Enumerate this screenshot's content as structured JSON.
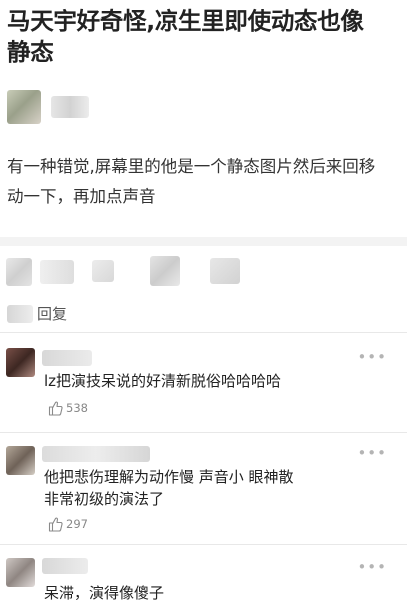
{
  "post": {
    "title_line1": "马天宇好奇怪,凉生里即使动态也像",
    "title_line2": "静态",
    "body_line1": "有一种错觉,屏幕里的他是一个静态图片然后来回移",
    "body_line2": "动一下，再加点声音"
  },
  "replies": {
    "header_label": "回复"
  },
  "comments": [
    {
      "text_lines": [
        "lz把演技呆说的好清新脱俗哈哈哈哈"
      ],
      "likes": "538"
    },
    {
      "text_lines": [
        "他把悲伤理解为动作慢 声音小 眼神散",
        "非常初级的演法了"
      ],
      "likes": "297"
    },
    {
      "text_lines": [
        "呆滞，演得像傻子"
      ],
      "likes": ""
    }
  ],
  "icons": {
    "more": "more-dots-icon",
    "like": "thumbs-up-icon"
  },
  "colors": {
    "background": "#ffffff",
    "text": "#222222",
    "muted": "#888888",
    "divider": "#f3f3f3"
  }
}
